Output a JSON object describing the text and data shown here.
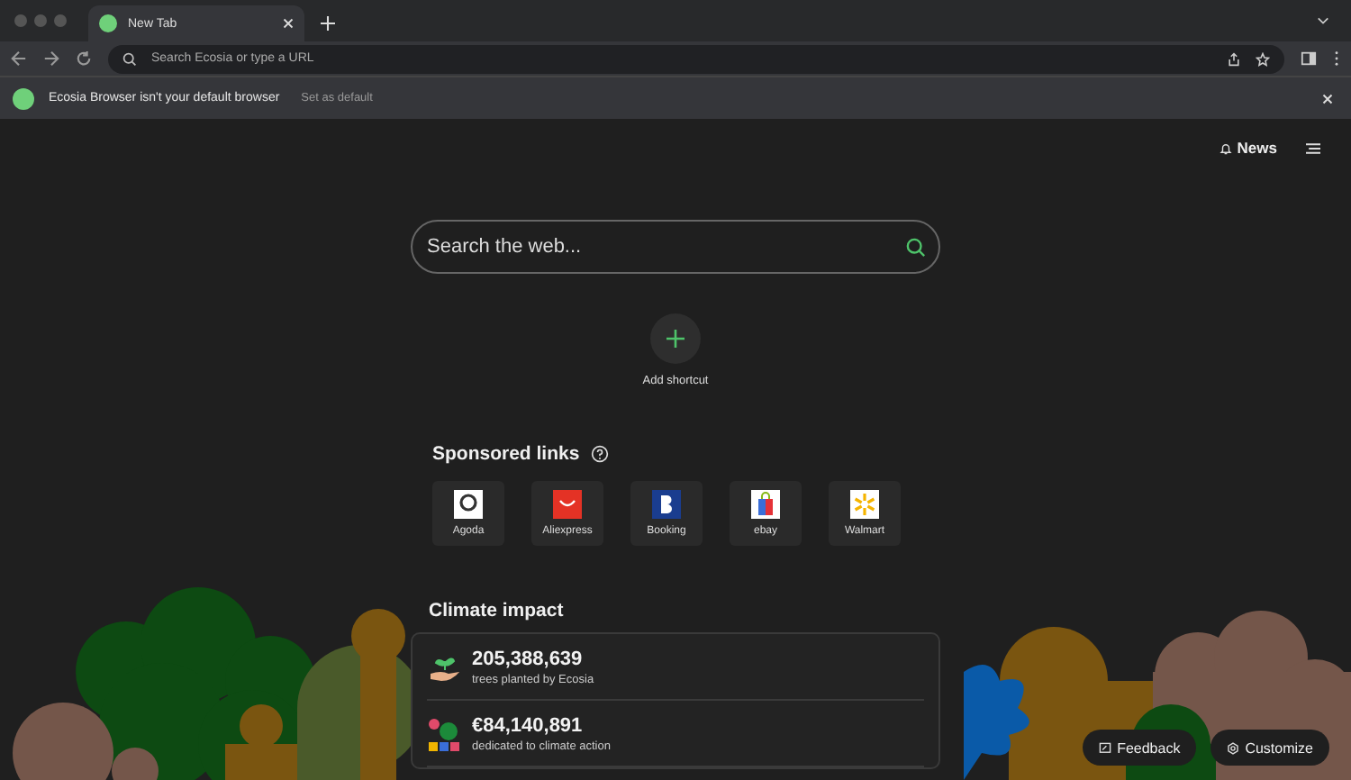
{
  "tab": {
    "title": "New Tab"
  },
  "address_bar": {
    "placeholder": "Search Ecosia or type a URL"
  },
  "infobar": {
    "message": "Ecosia Browser isn't your default browser",
    "action": "Set as default"
  },
  "header": {
    "news": "News"
  },
  "search": {
    "placeholder": "Search the web..."
  },
  "shortcut": {
    "label": "Add shortcut"
  },
  "sponsored": {
    "title": "Sponsored links",
    "links": [
      {
        "label": "Agoda",
        "kind": "agoda"
      },
      {
        "label": "Aliexpress",
        "kind": "aliexpress"
      },
      {
        "label": "Booking",
        "kind": "booking"
      },
      {
        "label": "ebay",
        "kind": "ebay"
      },
      {
        "label": "Walmart",
        "kind": "walmart"
      }
    ]
  },
  "climate": {
    "title": "Climate impact",
    "items": [
      {
        "value": "205,388,639",
        "label": "trees planted by Ecosia",
        "kind": "trees"
      },
      {
        "value": "€84,140,891",
        "label": "dedicated to climate action",
        "kind": "money"
      }
    ]
  },
  "footer": {
    "feedback": "Feedback",
    "customize": "Customize"
  }
}
